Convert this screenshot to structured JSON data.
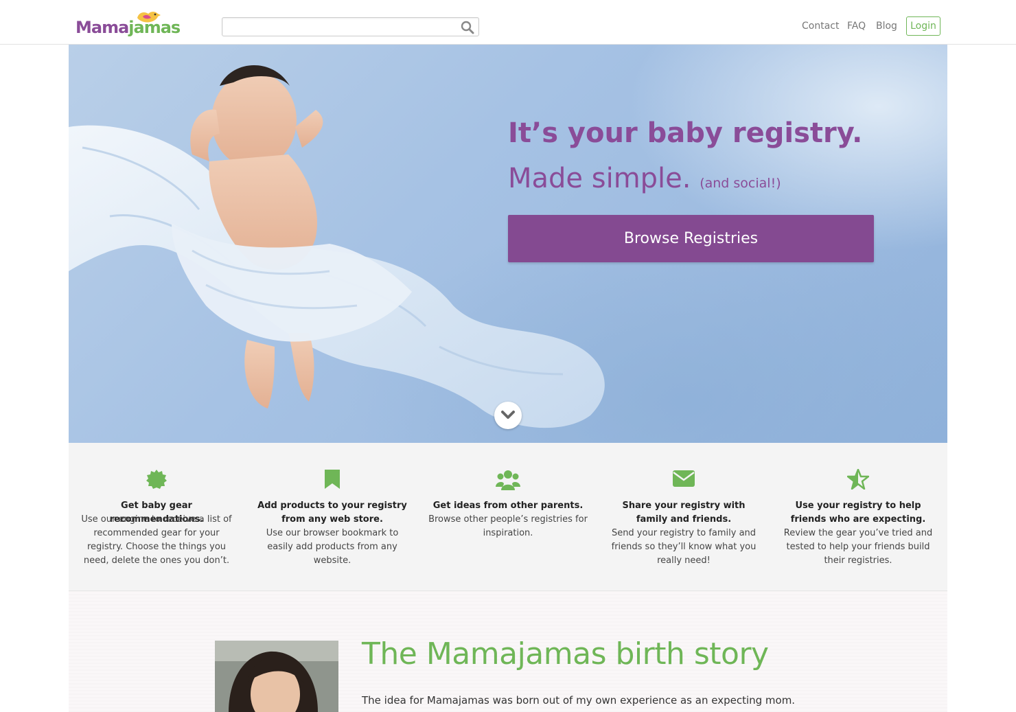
{
  "header": {
    "logo_left": "Mama",
    "logo_right": "jamas",
    "search": {
      "placeholder": "",
      "value": ""
    },
    "nav": {
      "contact": "Contact",
      "faq": "FAQ",
      "blog": "Blog",
      "login": "Login"
    }
  },
  "hero": {
    "title": "It’s your baby registry.",
    "subtitle": "Made simple.",
    "subtitle_small": "(and social!)",
    "cta": "Browse Registries"
  },
  "features": [
    {
      "icon": "badge-icon",
      "title": "Get baby gear recommendations.",
      "description": "Use our engine to receive a list of recommended gear for your registry. Choose the things you need, delete the ones you don’t."
    },
    {
      "icon": "bookmark-icon",
      "title": "Add products to your registry from any web store.",
      "description": "Use our browser bookmark to easily add products from any website."
    },
    {
      "icon": "group-icon",
      "title": "Get ideas from other parents.",
      "description": "Browse other people’s registries for inspiration."
    },
    {
      "icon": "envelope-icon",
      "title": "Share your registry with family and friends.",
      "description": "Send your registry to family and friends so they’ll know what you really need!"
    },
    {
      "icon": "star-half-icon",
      "title": "Use your registry to help friends who are expecting.",
      "description": "Review the gear you’ve tried and tested to help your friends build their registries."
    }
  ],
  "story": {
    "title": "The Mamajamas birth story",
    "text": "The idea for Mamajamas was born out of my own experience as an expecting mom."
  },
  "colors": {
    "purple": "#844a91",
    "green": "#6fb657",
    "hero_blue": "#a6c2e4"
  }
}
